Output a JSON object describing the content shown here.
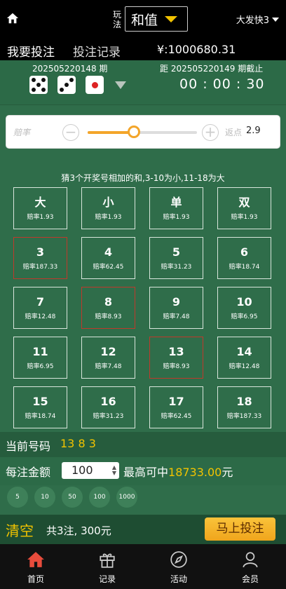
{
  "header": {
    "play_label": "玩法",
    "play_value": "和值",
    "lottery_name": "大发快3"
  },
  "tabs": [
    {
      "label": "我要投注"
    },
    {
      "label": "投注记录"
    }
  ],
  "balance": "¥:1000680.31",
  "period": {
    "current": "202505220148 期",
    "next": "距 202505220149 期截止",
    "countdown": "00 : 00 : 30"
  },
  "odds_slider": {
    "label": "赔率",
    "rebate_label": "返点",
    "rebate_value": "2.9",
    "position": 0.42
  },
  "rule_text": "猜3个开奖号相加的和,3-10为小,11-18为大",
  "bets": [
    {
      "name": "大",
      "odds": "赔率1.93",
      "selected": false
    },
    {
      "name": "小",
      "odds": "赔率1.93",
      "selected": false
    },
    {
      "name": "单",
      "odds": "赔率1.93",
      "selected": false
    },
    {
      "name": "双",
      "odds": "赔率1.93",
      "selected": false
    },
    {
      "name": "3",
      "odds": "赔率187.33",
      "selected": true
    },
    {
      "name": "4",
      "odds": "赔率62.45",
      "selected": false
    },
    {
      "name": "5",
      "odds": "赔率31.23",
      "selected": false
    },
    {
      "name": "6",
      "odds": "赔率18.74",
      "selected": false
    },
    {
      "name": "7",
      "odds": "赔率12.48",
      "selected": false
    },
    {
      "name": "8",
      "odds": "赔率8.93",
      "selected": true
    },
    {
      "name": "9",
      "odds": "赔率7.48",
      "selected": false
    },
    {
      "name": "10",
      "odds": "赔率6.95",
      "selected": false
    },
    {
      "name": "11",
      "odds": "赔率6.95",
      "selected": false
    },
    {
      "name": "12",
      "odds": "赔率7.48",
      "selected": false
    },
    {
      "name": "13",
      "odds": "赔率8.93",
      "selected": true
    },
    {
      "name": "14",
      "odds": "赔率12.48",
      "selected": false
    },
    {
      "name": "15",
      "odds": "赔率18.74",
      "selected": false
    },
    {
      "name": "16",
      "odds": "赔率31.23",
      "selected": false
    },
    {
      "name": "17",
      "odds": "赔率62.45",
      "selected": false
    },
    {
      "name": "18",
      "odds": "赔率187.33",
      "selected": false
    }
  ],
  "current_numbers": {
    "label": "当前号码",
    "value": "13 8 3"
  },
  "amount": {
    "label": "每注金额",
    "value": "100",
    "max_label": "最高可中",
    "max_value": "18733.00",
    "max_unit": "元"
  },
  "chips": [
    "5",
    "10",
    "50",
    "100",
    "1000"
  ],
  "bet_bar": {
    "clear_label": "清空",
    "summary": "共3注, 300元",
    "submit_label": "马上投注"
  },
  "nav": [
    {
      "label": "首页",
      "icon": "home-icon"
    },
    {
      "label": "记录",
      "icon": "gift-icon"
    },
    {
      "label": "活动",
      "icon": "compass-icon"
    },
    {
      "label": "会员",
      "icon": "user-icon"
    }
  ],
  "colors": {
    "accent": "#f2c300",
    "background": "#2f6d4a",
    "selected_border": "#c0392b",
    "nav_active": "#e74c3c"
  }
}
